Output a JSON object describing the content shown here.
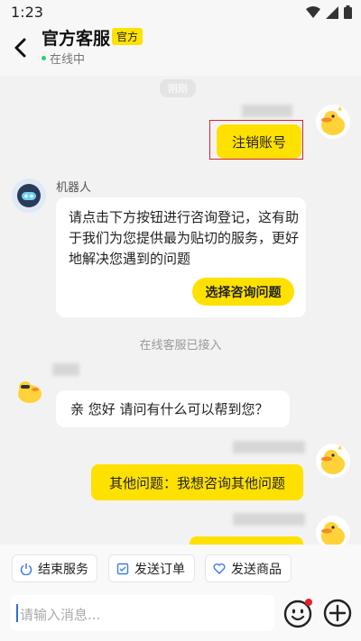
{
  "status_bar": {
    "time": "1:23"
  },
  "header": {
    "title": "官方客服",
    "badge": "官方",
    "status": "在线中"
  },
  "messages": {
    "time_chip": "刚刚",
    "user_msg_1": "注销账号",
    "robot_name": "机器人",
    "robot_text": "请点击下方按钮进行咨询登记，这有助于我们为您提供最为贴切的服务，更好地解决您遇到的问题",
    "robot_button": "选择咨询问题",
    "system_note": "在线客服已接入",
    "agent_msg": "亲 您好 请问有什么可以帮到您？",
    "user_msg_2": "其他问题：我想咨询其他问题"
  },
  "quick_actions": {
    "end": "结束服务",
    "send_order": "发送订单",
    "send_product": "发送商品"
  },
  "input": {
    "placeholder": "请输入消息..."
  },
  "colors": {
    "accent": "#ffe100",
    "highlight_frame": "#d9232c",
    "online": "#2ecc71"
  }
}
